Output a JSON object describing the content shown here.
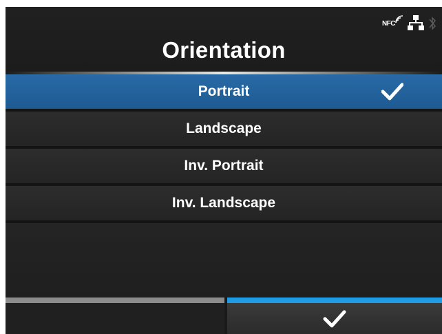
{
  "header": {
    "title": "Orientation",
    "status": {
      "nfc_label": "NFC",
      "icons": [
        "nfc-icon",
        "network-icon",
        "bluetooth-icon"
      ]
    }
  },
  "options": [
    {
      "label": "Portrait",
      "selected": true
    },
    {
      "label": "Landscape",
      "selected": false
    },
    {
      "label": "Inv. Portrait",
      "selected": false
    },
    {
      "label": "Inv. Landscape",
      "selected": false
    }
  ],
  "softkeys": {
    "left": {
      "icon": ""
    },
    "right": {
      "icon": "check-icon"
    }
  },
  "colors": {
    "selected_row": "#246399",
    "accent_blue": "#1e9ce6",
    "background": "#1a1a1a",
    "row": "#2a2a2a"
  }
}
